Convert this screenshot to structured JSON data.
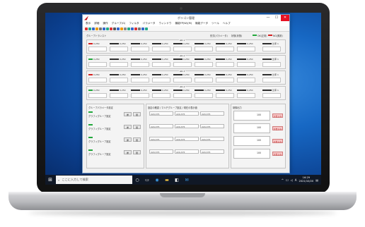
{
  "window": {
    "title": "ポリゴン管理",
    "min": "—",
    "max": "☐",
    "close": "✕"
  },
  "menubar": [
    "表示",
    "詳細",
    "操作",
    "グループ(G)",
    "フィルタ",
    "パラメータ",
    "ウィンドウ",
    "機能FP(W)(M)",
    "機能データ",
    "ツール",
    "ヘルプ"
  ],
  "panel_top": {
    "left_label": "グループトランスト",
    "field_label": "形式(パラメータ)",
    "status_label": "状態(状態)",
    "legend_ok": "OK(正常)",
    "legend_ng": "NG(異常)"
  },
  "groups": [
    {
      "label": "GR 1",
      "value": "0,250",
      "unit": "比率 1"
    },
    {
      "label": "GR 2",
      "value": "0,250",
      "unit": "比率 1"
    },
    {
      "label": "GR 3",
      "value": "0,250",
      "unit": "比率 1"
    },
    {
      "label": "GR 4",
      "value": "0,250",
      "unit": "比率 1"
    }
  ],
  "bottom": {
    "left_title": "グループパラメータ設定",
    "row_text": "グラフィグループ設定",
    "btn_a": "参",
    "btn_b": "閉",
    "mid_title": "設定の確認 / マルチグループ設定 / 現在の表示値",
    "mid_values": [
      "220,375",
      "220,375",
      "220,375"
    ],
    "right_title": "制御出力",
    "right_label": "出力\nグループ",
    "right_value": "100",
    "right_btn": "リセット"
  },
  "taskbar": {
    "search_placeholder": "ここに入力して検索",
    "time": "16:29",
    "date": "2021/10/20",
    "ime": "A"
  },
  "colors": {
    "ok": "#22a83c",
    "ng": "#d42020",
    "accent": "#1768c4"
  }
}
